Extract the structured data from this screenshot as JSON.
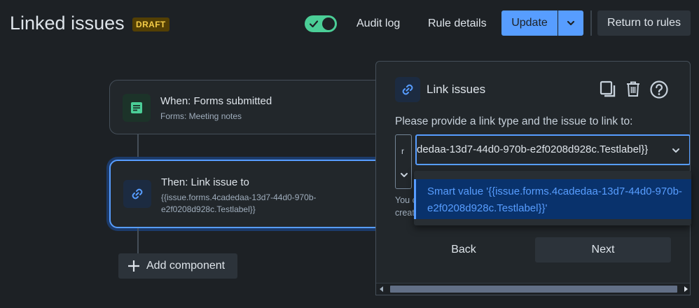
{
  "header": {
    "title": "Linked issues",
    "badge": "DRAFT",
    "toggle_on": true,
    "audit_log": "Audit log",
    "rule_details": "Rule details",
    "update": "Update",
    "return_to_rules": "Return to rules"
  },
  "flow": {
    "trigger": {
      "title": "When: Forms submitted",
      "subtitle": "Forms: Meeting notes"
    },
    "action": {
      "title": "Then: Link issue to",
      "subtitle": "{{issue.forms.4cadedaa-13d7-44d0-970b-e2f0208d928c.Testlabel}}"
    },
    "add_component": "Add component"
  },
  "panel": {
    "title": "Link issues",
    "instruction": "Please provide a link type and the issue to link to:",
    "link_type_value": "r",
    "issue_value": "dedaa-13d7-44d0-970b-e2f0208d928c.Testlabel}}",
    "hint_line1": "You c",
    "hint_line2": "creat",
    "dropdown_option": "Smart value '{{issue.forms.4cadedaa-13d7-44d0-970b-e2f0208d928c.Testlabel}}'",
    "back": "Back",
    "next": "Next"
  },
  "colors": {
    "background": "#1d2125",
    "accent": "#579dff",
    "toggle": "#4bce97",
    "draft_text": "#f5cd47"
  }
}
